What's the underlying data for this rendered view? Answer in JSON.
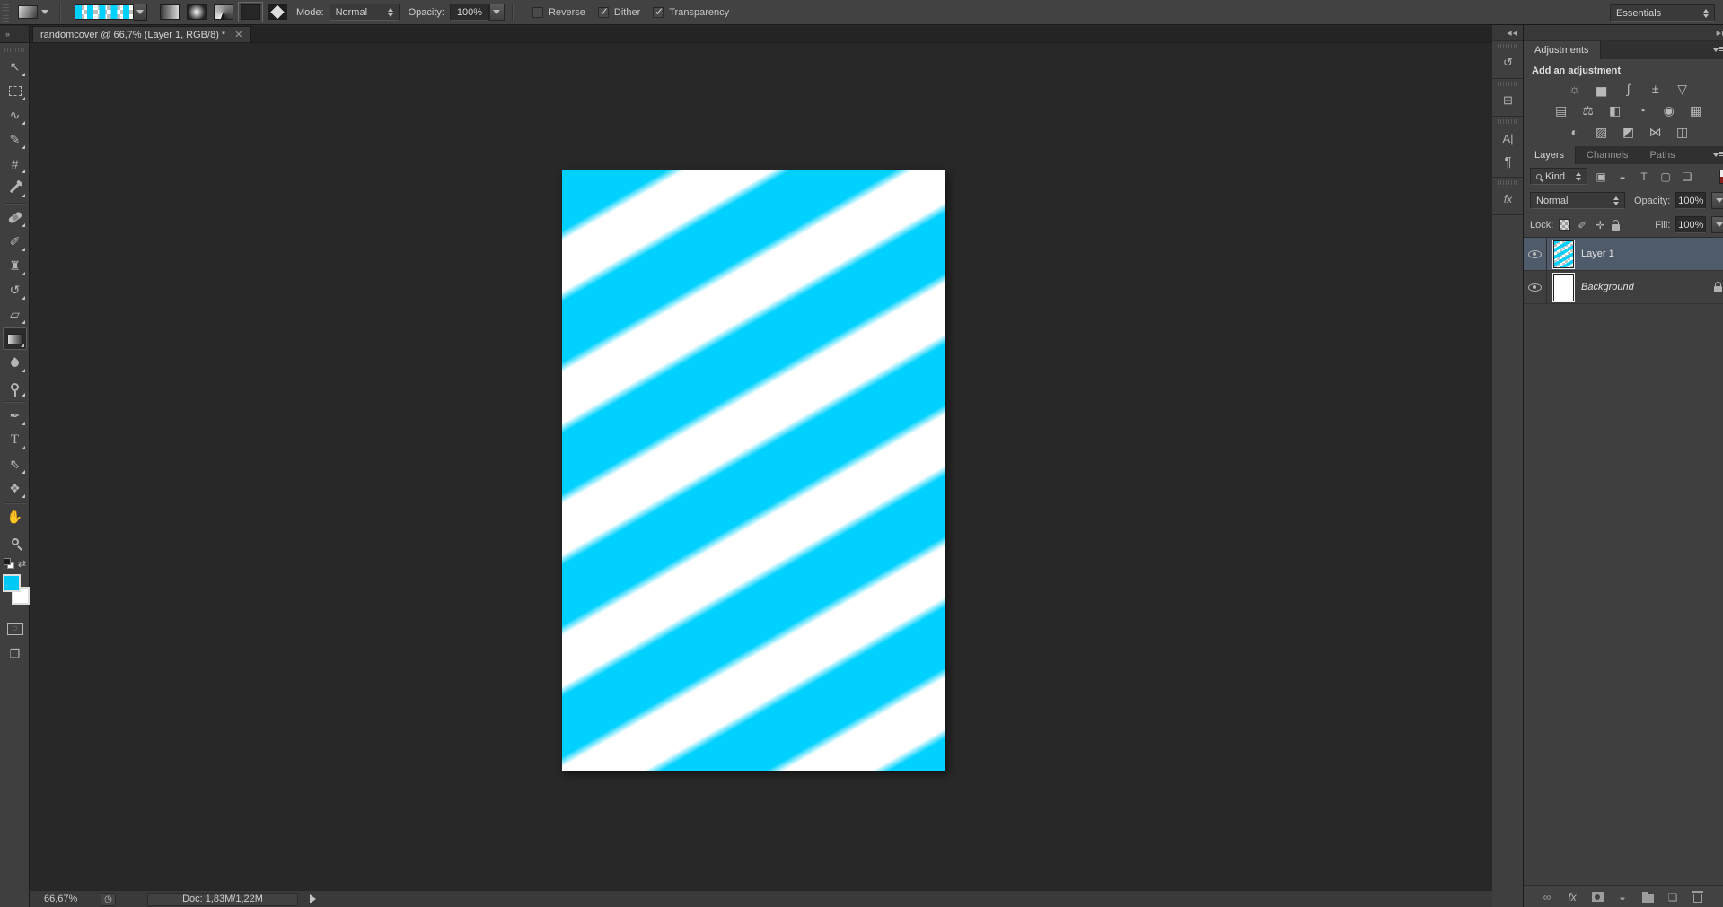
{
  "colors": {
    "accent_cyan": "#00d1ff",
    "selected_layer_bg": "#4f5b6a",
    "panel_bg": "#424242"
  },
  "options_bar": {
    "mode_label": "Mode:",
    "mode_value": "Normal",
    "opacity_label": "Opacity:",
    "opacity_value": "100%",
    "reverse_label": "Reverse",
    "dither_label": "Dither",
    "transparency_label": "Transparency",
    "workspace": "Essentials"
  },
  "tab": {
    "title": "randomcover @ 66,7% (Layer 1, RGB/8) *",
    "close": "✕"
  },
  "icons": {
    "toolbar_expand": "»",
    "strip_collapse": "◀◀",
    "panel_collapse": "▶▶",
    "move": "↖",
    "lasso": "∿",
    "quick_selection": "✎",
    "crop": "#",
    "brush": "✐",
    "clone_stamp": "♜",
    "history_brush": "↺",
    "eraser": "▱",
    "pen": "✒",
    "type_tool": "T",
    "path_select": "⇖",
    "custom_shape": "❖",
    "hand": "✋",
    "swap_colors": "⇄",
    "quick_mask": "◌",
    "screen_mode": "❐",
    "adj_brightness": "☼",
    "adj_levels": "▅",
    "adj_curves": "∫",
    "adj_exposure": "±",
    "adj_vibrance": "▽",
    "adj_hue_saturation": "▤",
    "adj_color_balance": "⚖",
    "adj_black_white": "◧",
    "adj_photo_filter": "◔",
    "adj_channel_mixer": "◉",
    "adj_color_lookup": "▦",
    "adj_invert": "◐",
    "adj_posterize": "▨",
    "adj_threshold": "◩",
    "adj_gradient_map": "⋈",
    "adj_selective_color": "◫",
    "filter_image": "▣",
    "filter_adjustment": "◒",
    "filter_type": "T",
    "filter_shape": "▢",
    "filter_smart_object": "❏",
    "lock_brush": "✐",
    "lock_position": "✛",
    "link": "∞",
    "fx": "fx",
    "new_layer": "❏",
    "adjustment_circle": "◒",
    "panel_history": "↺",
    "panel_properties": "⊞",
    "panel_character": "A|",
    "panel_paragraph": "¶",
    "panel_styles": "fx",
    "status_page": "◷"
  },
  "adjustments": {
    "tab_label": "Adjustments",
    "title": "Add an adjustment"
  },
  "layers_panel": {
    "tab_layers": "Layers",
    "tab_channels": "Channels",
    "tab_paths": "Paths",
    "kind_label": "Kind",
    "blend_mode": "Normal",
    "opacity_label": "Opacity:",
    "opacity_value": "100%",
    "lock_label": "Lock:",
    "fill_label": "Fill:",
    "fill_value": "100%",
    "layers": [
      {
        "name": "Layer 1",
        "selected": true
      },
      {
        "name": "Background",
        "selected": false,
        "locked": true
      }
    ]
  },
  "status_bar": {
    "zoom": "66,67%",
    "doc_sizes": "Doc: 1,83M/1,22M"
  }
}
